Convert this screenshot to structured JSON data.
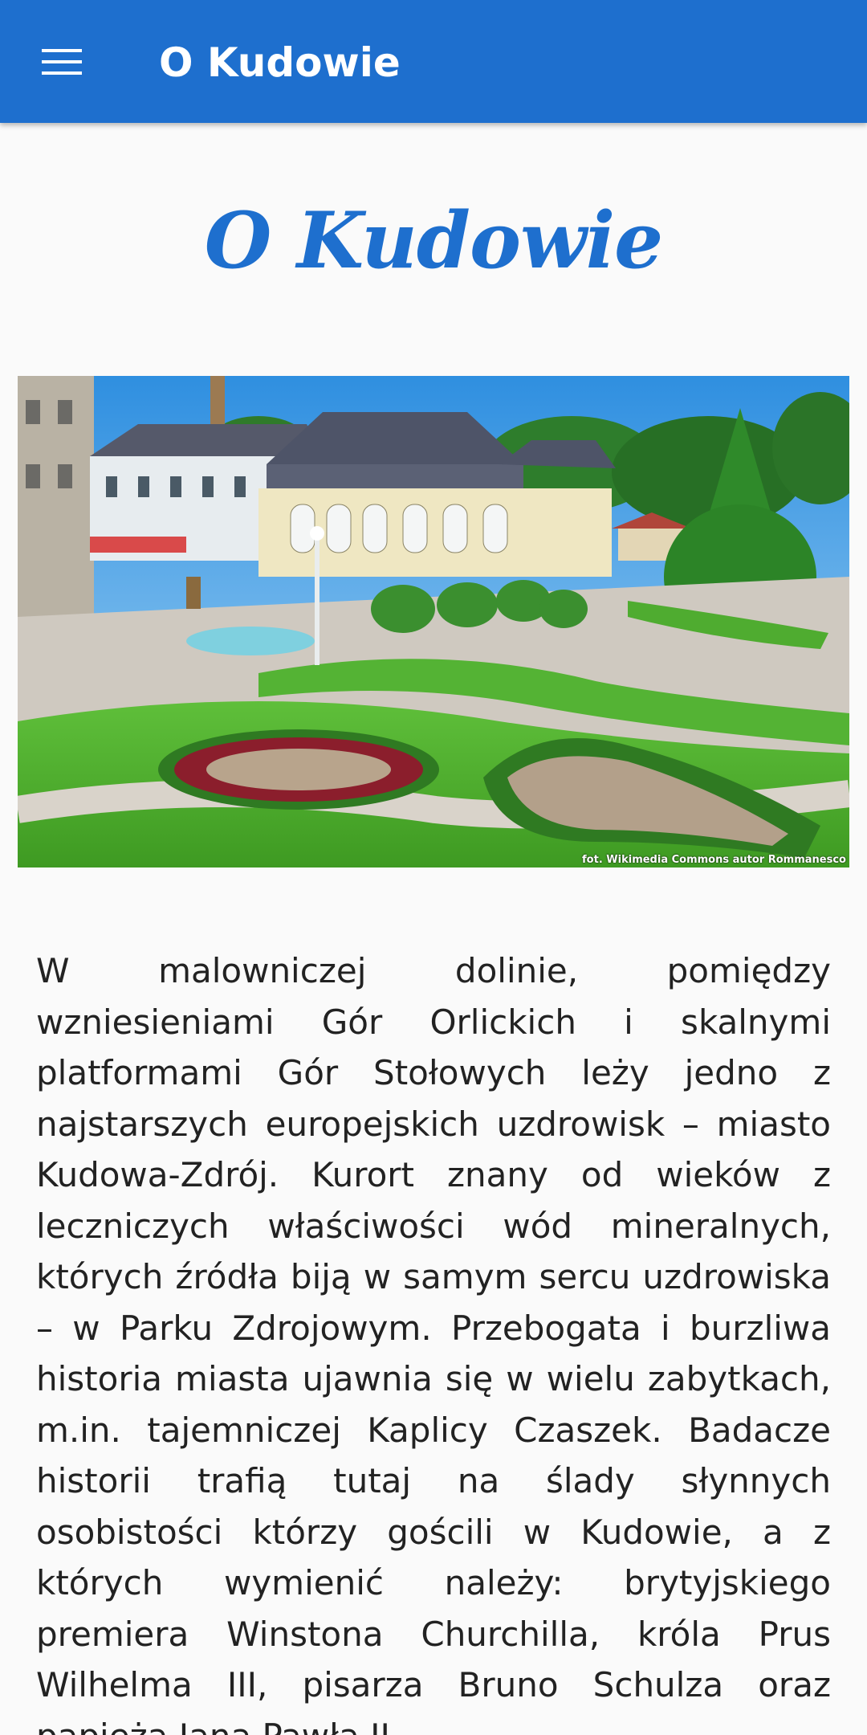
{
  "app_bar": {
    "menu_icon": "hamburger-menu-icon",
    "title": "O Kudowie",
    "background_color": "#1e6fce"
  },
  "page": {
    "heading": "O Kudowie",
    "heading_color": "#1e6fce",
    "image": {
      "description": "spa-park-photo",
      "credit": "fot. Wikimedia Commons autor Rommanesco"
    },
    "article_text": "W malowniczej dolinie, pomiędzy wzniesieniami Gór Orlickich i skalnymi platformami Gór Stołowych leży jedno z najstarszych europejskich uzdrowisk – miasto Kudowa-Zdrój. Kurort znany od wieków z leczniczych właściwości wód mineralnych, których źródła biją w samym sercu uzdrowiska – w Parku Zdrojowym. Przebogata i burzliwa historia miasta ujawnia się w wielu zabytkach, m.in. tajemniczej Kaplicy Czaszek. Badacze historii trafią tutaj na ślady słynnych osobistości którzy gościli w Kudowie, a z których wymienić należy: brytyjskiego premiera Winstona Churchilla, króla Prus Wilhelma III, pisarza Bruno Schulza oraz papieża Jana Pawła II."
  }
}
